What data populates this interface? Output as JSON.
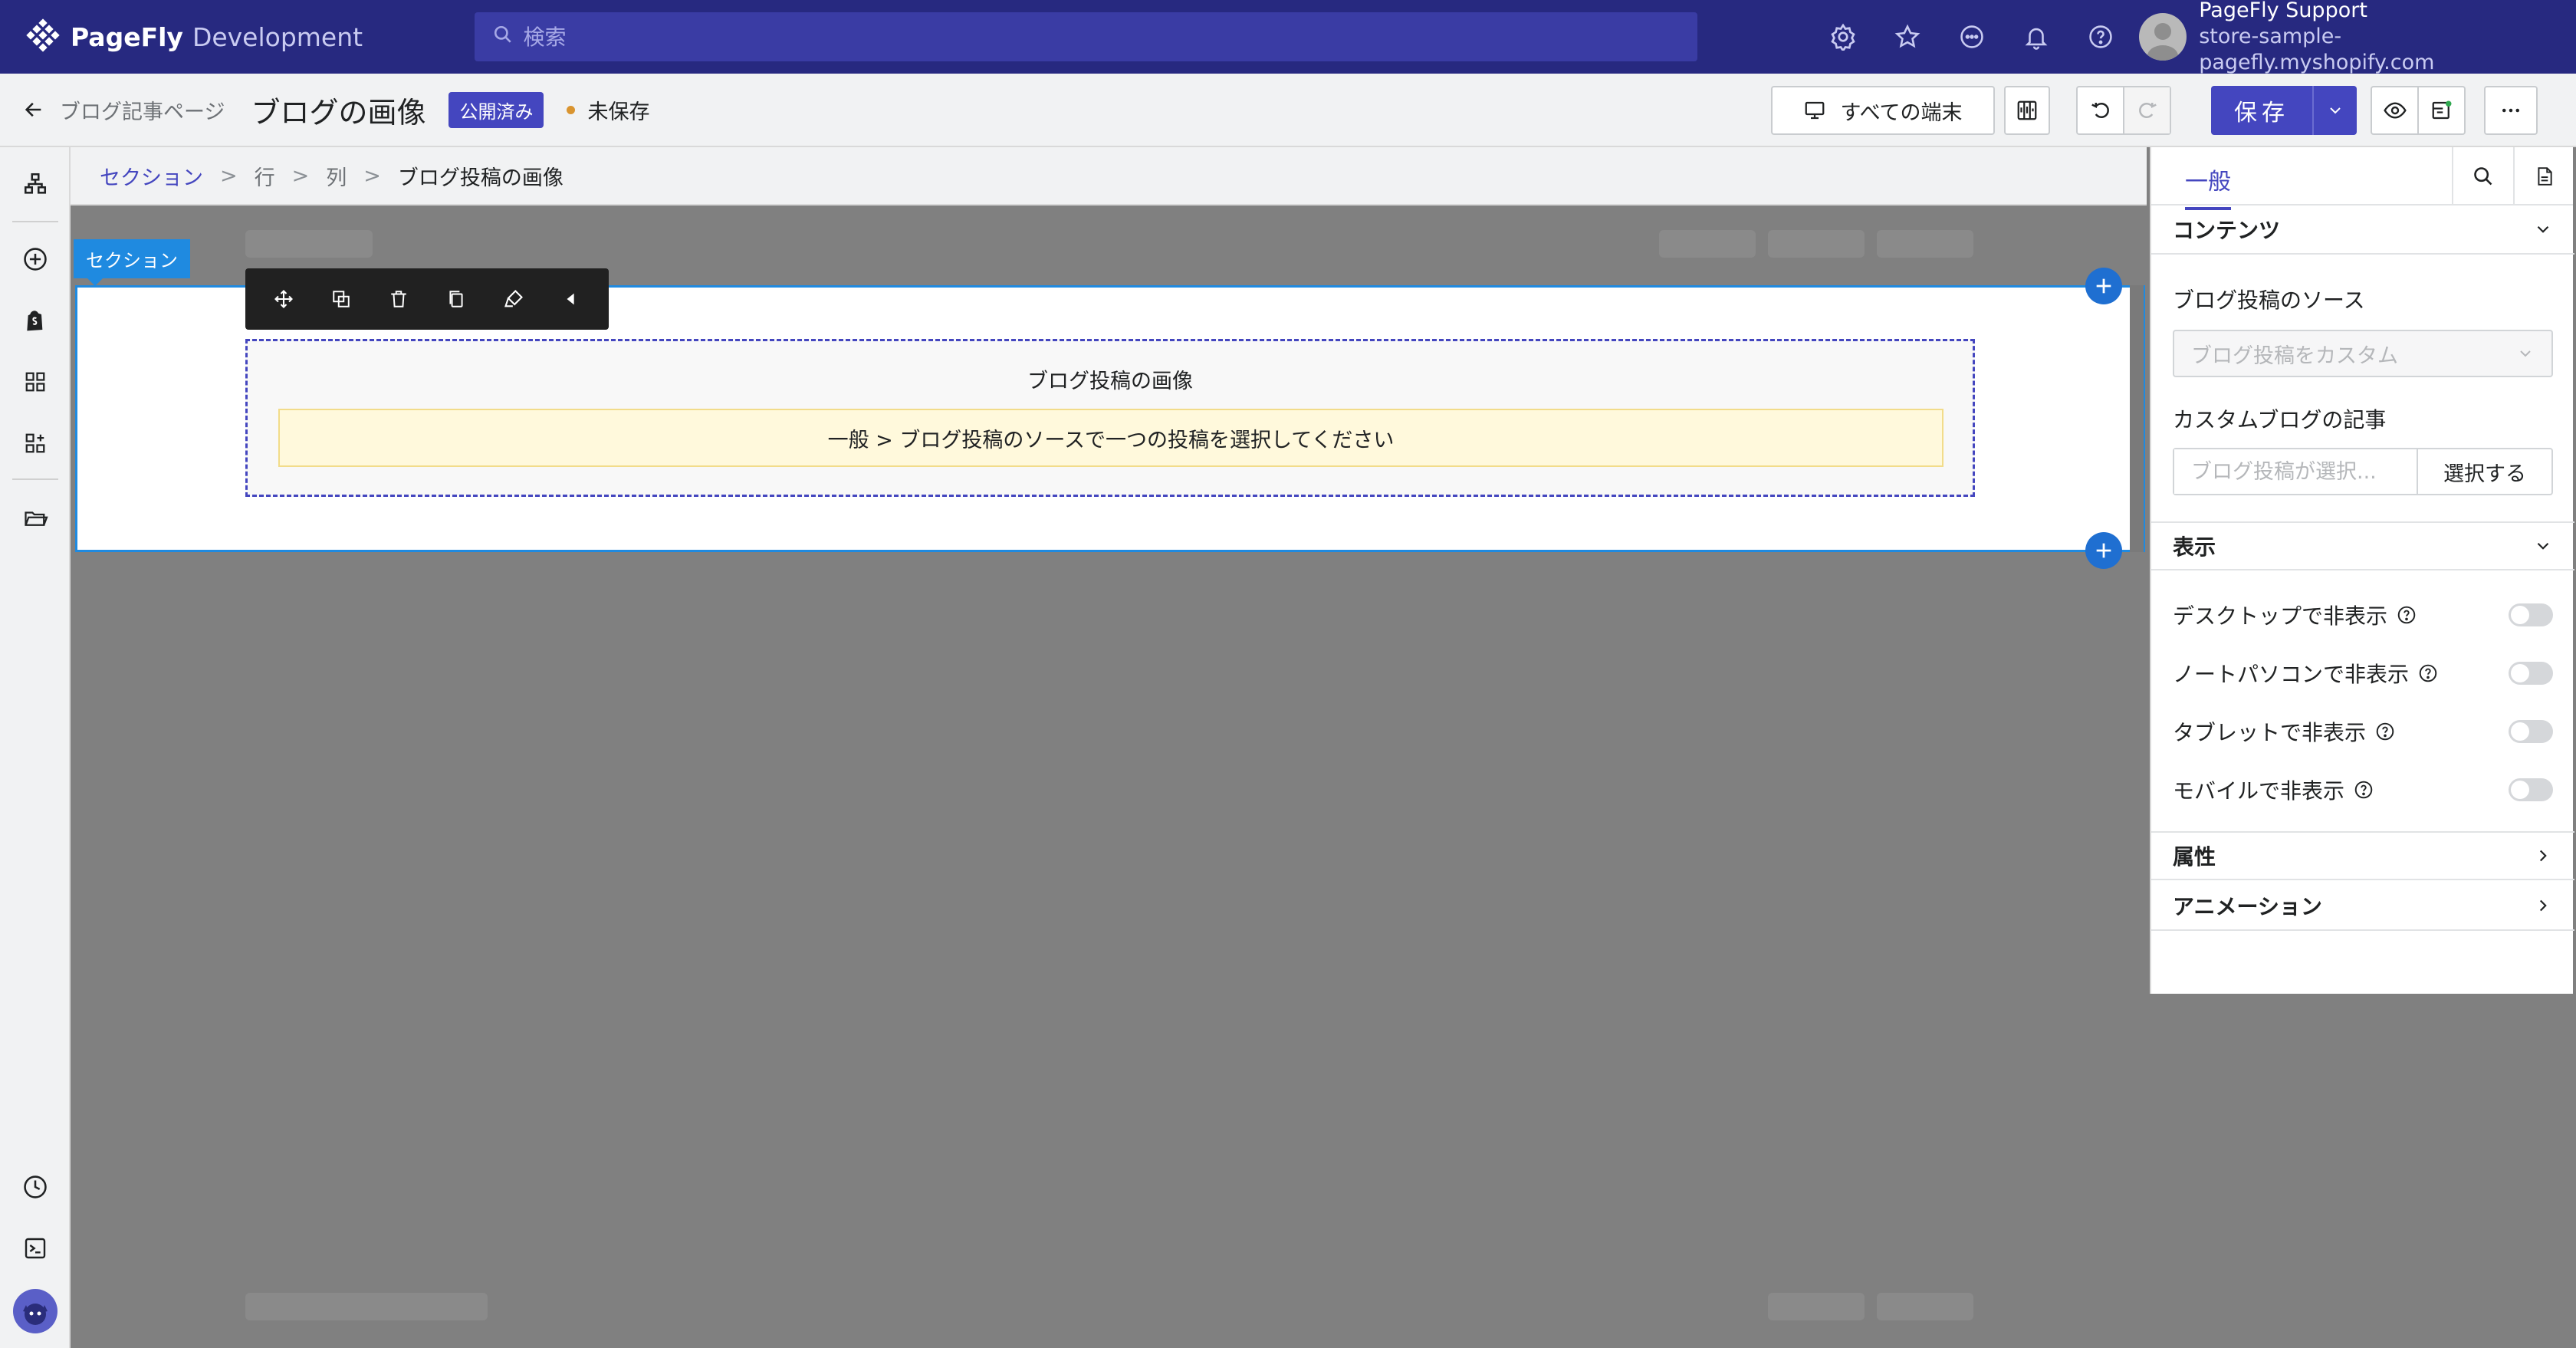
{
  "topbar": {
    "brand": "PageFly",
    "env": "Development",
    "search_placeholder": "検索",
    "user_name": "PageFly Support",
    "user_store": "store-sample-pagefly.myshopify.com"
  },
  "header": {
    "back_label": "ブログ記事ページ",
    "page_title": "ブログの画像",
    "status_badge": "公開済み",
    "unsaved_label": "未保存",
    "devices_label": "すべての端末",
    "save_label": "保存"
  },
  "breadcrumb": {
    "section": "セクション",
    "row": "行",
    "column": "列",
    "current": "ブログ投稿の画像"
  },
  "canvas": {
    "section_tag": "セクション",
    "element_title": "ブログ投稿の画像",
    "element_message": "一般 > ブログ投稿のソースで一つの投稿を選択してください"
  },
  "panel": {
    "tab_general": "一般",
    "content_heading": "コンテンツ",
    "source_label": "ブログ投稿のソース",
    "source_value": "ブログ投稿をカスタム",
    "custom_label": "カスタムブログの記事",
    "custom_placeholder": "ブログ投稿が選択...",
    "select_button": "選択する",
    "display_heading": "表示",
    "toggles": [
      {
        "label": "デスクトップで非表示",
        "on": false
      },
      {
        "label": "ノートパソコンで非表示",
        "on": false
      },
      {
        "label": "タブレットで非表示",
        "on": false
      },
      {
        "label": "モバイルで非表示",
        "on": false
      }
    ],
    "attributes_heading": "属性",
    "animation_heading": "アニメーション"
  },
  "colors": {
    "brand_bar": "#272980",
    "accent": "#4446bf",
    "selection": "#1f8ae0",
    "warning_bg": "#fff9dc"
  },
  "icons": [
    "pagefly-logo-icon",
    "search-icon",
    "settings-icon",
    "star-icon",
    "chat-icon",
    "bell-icon",
    "help-icon",
    "arrow-left-icon",
    "desktop-icon",
    "columns-icon",
    "undo-icon",
    "redo-icon",
    "chevron-down-icon",
    "eye-icon",
    "layout-icon",
    "more-icon"
  ]
}
